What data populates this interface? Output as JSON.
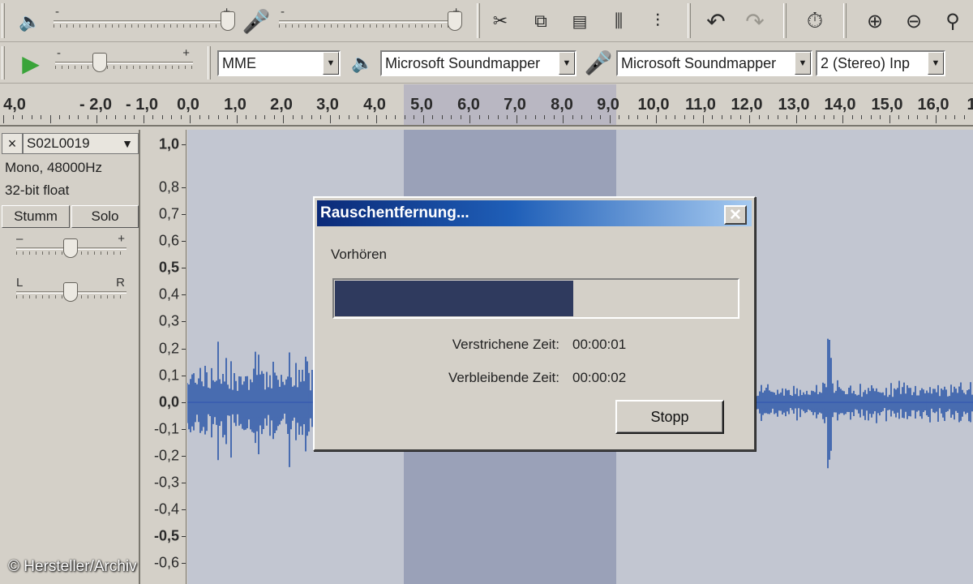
{
  "toolbar": {
    "tools": [
      {
        "icon": "scissors-icon",
        "glyph": "✂"
      },
      {
        "icon": "copy-icon",
        "glyph": "⧉"
      },
      {
        "icon": "paste-icon",
        "glyph": "📋"
      },
      {
        "icon": "trim-icon",
        "glyph": "⫼"
      },
      {
        "icon": "silence-icon",
        "glyph": "⫶"
      },
      {
        "icon": "undo-icon",
        "glyph": "↶"
      },
      {
        "icon": "redo-icon",
        "glyph": "↷"
      },
      {
        "icon": "timer-icon",
        "glyph": "⏱"
      },
      {
        "icon": "zoom-in-icon",
        "glyph": "🔍"
      },
      {
        "icon": "zoom-out-icon",
        "glyph": "🔎"
      },
      {
        "icon": "zoom-fit-icon",
        "glyph": "⚲"
      }
    ],
    "output_slider_minus": "-",
    "output_slider_plus": "+",
    "speed_minus": "-",
    "speed_plus": "+",
    "host": "MME",
    "output_device": "Microsoft Soundmapper",
    "input_device": "Microsoft Soundmapper",
    "channels": "2 (Stereo) Inp"
  },
  "ruler": {
    "labels": [
      "4,0",
      "- 2,0",
      "- 1,0",
      "0,0",
      "1,0",
      "2,0",
      "3,0",
      "4,0",
      "5,0",
      "6,0",
      "7,0",
      "8,0",
      "9,0",
      "10,0",
      "11,0",
      "12,0",
      "13,0",
      "14,0",
      "15,0",
      "16,0",
      "1"
    ]
  },
  "track": {
    "name": "S02L0019",
    "close": "×",
    "format": "Mono, 48000Hz",
    "bitdepth": "32-bit float",
    "mute_label": "Stumm",
    "solo_label": "Solo",
    "gain_minus": "–",
    "gain_plus": "+",
    "pan_left": "L",
    "pan_right": "R"
  },
  "vscale": {
    "labels": [
      "1,0",
      "0,8",
      "0,7",
      "0,6",
      "0,5",
      "0,4",
      "0,3",
      "0,2",
      "0,1",
      "0,0",
      "-0,1",
      "-0,2",
      "-0,3",
      "-0,4",
      "-0,5",
      "-0,6"
    ]
  },
  "dialog": {
    "title": "Rauschentfernung...",
    "close_label": "✕",
    "caption": "Vorhören",
    "progress": 0.59,
    "elapsed_label": "Verstrichene Zeit:",
    "elapsed_value": "00:00:01",
    "remaining_label": "Verbleibende Zeit:",
    "remaining_value": "00:00:02",
    "stop_label": "Stopp"
  },
  "copyright": "© Hersteller/Archiv",
  "colors": {
    "waveform": "#2a55a8",
    "selection": "#9aa1b8",
    "progress_fill": "#2f3a5e",
    "title_start": "#0b2a78",
    "play_green": "#3aa43a"
  }
}
